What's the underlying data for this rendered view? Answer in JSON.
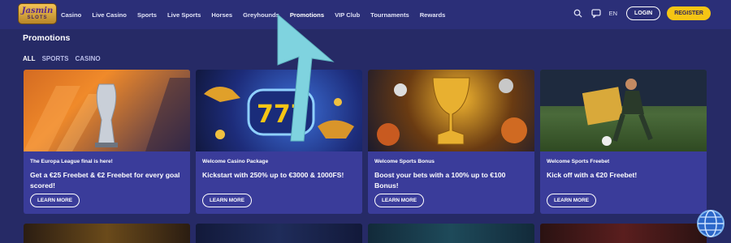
{
  "logo": {
    "line1": "Jasmin",
    "line2": "SLOTS"
  },
  "nav": [
    "Casino",
    "Live Casino",
    "Sports",
    "Live Sports",
    "Horses",
    "Greyhounds",
    "Promotions",
    "VIP Club",
    "Tournaments",
    "Rewards"
  ],
  "active_nav": "Promotions",
  "header": {
    "language": "EN",
    "login": "LOGIN",
    "register": "REGISTER"
  },
  "page_title": "Promotions",
  "filters": [
    "ALL",
    "SPORTS",
    "CASINO"
  ],
  "cards": [
    {
      "tag": "The Europa League final is here!",
      "title": "Get a €25 Freebet & €2 Freebet for every goal scored!",
      "button": "LEARN MORE"
    },
    {
      "tag": "Welcome Casino Package",
      "title": "Kickstart with 250% up to €3000 & 1000FS!",
      "button": "LEARN MORE"
    },
    {
      "tag": "Welcome Sports Bonus",
      "title": "Boost your bets with a 100% up to €100 Bonus!",
      "button": "LEARN MORE"
    },
    {
      "tag": "Welcome Sports Freebet",
      "title": "Kick off with a €20 Freebet!",
      "button": "LEARN MORE"
    }
  ],
  "colors": {
    "background": "#262a66",
    "header": "#2b2f78",
    "card": "#3a3c9a",
    "accent": "#f6c514",
    "arrow": "#7fd3df"
  }
}
